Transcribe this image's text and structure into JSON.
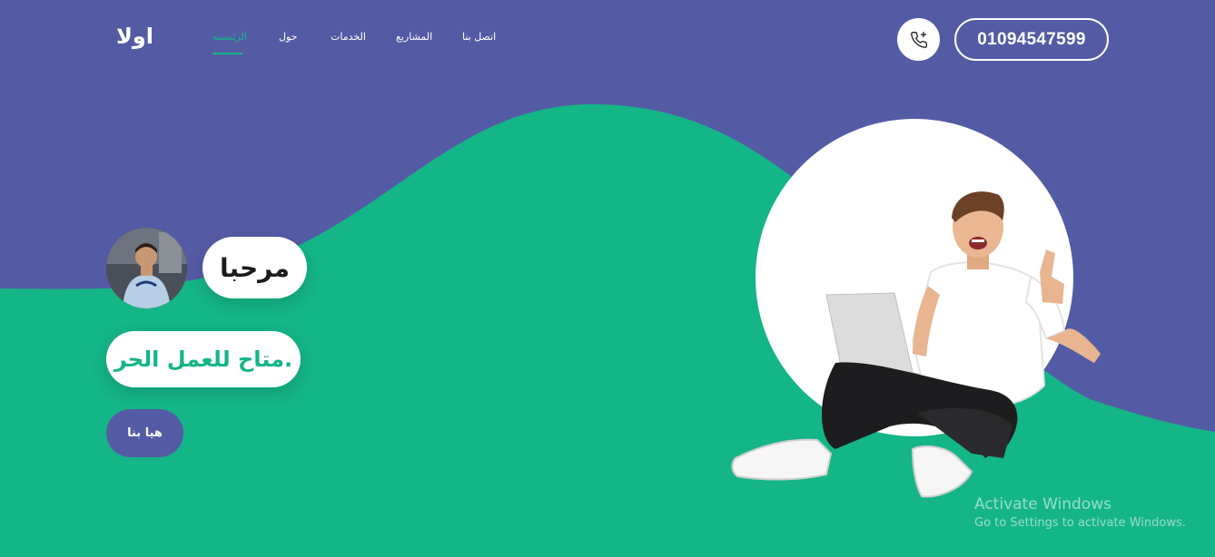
{
  "header": {
    "logo": "اولا",
    "nav": [
      {
        "label": "الرئيسيه",
        "active": true
      },
      {
        "label": "حول",
        "active": false
      },
      {
        "label": "الخدمات",
        "active": false
      },
      {
        "label": "المشاريع",
        "active": false
      },
      {
        "label": "اتصل بنا",
        "active": false
      }
    ],
    "phone_number": "01094547599",
    "phone_icon": "phone-plus-icon"
  },
  "hero": {
    "greeting": "مرحبا",
    "tagline": "متاح للعمل الحر.",
    "cta_label": "هيا بنا"
  },
  "watermark": {
    "title": "Activate Windows",
    "subtitle": "Go to Settings to activate Windows."
  },
  "colors": {
    "purple": "#545ba5",
    "green": "#14b587",
    "white": "#ffffff"
  }
}
